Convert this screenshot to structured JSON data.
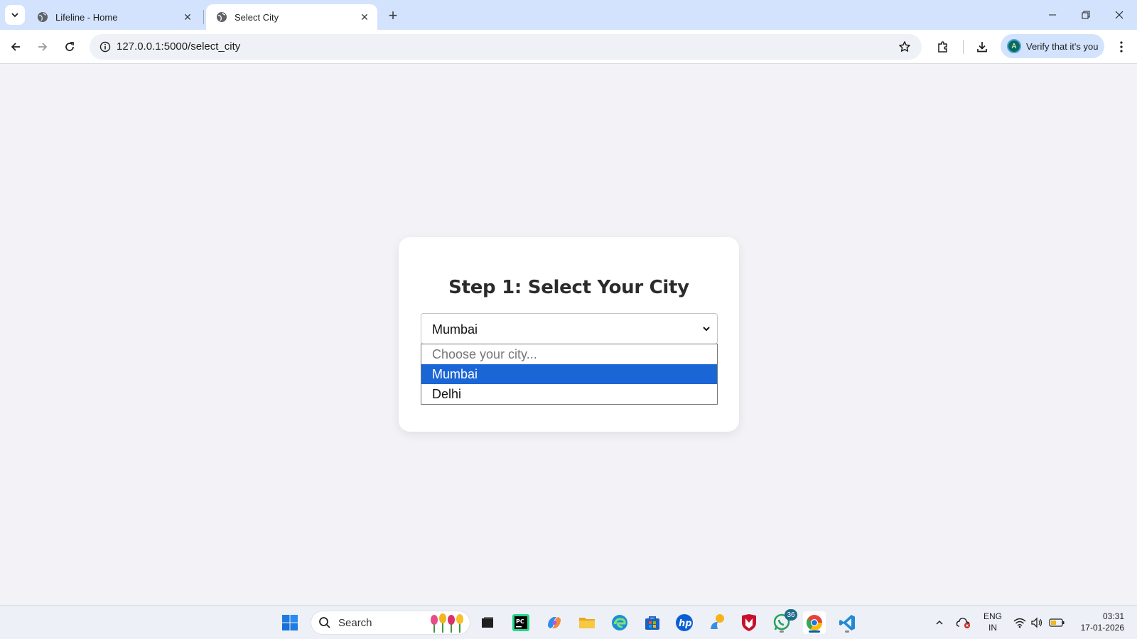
{
  "browser": {
    "tabs": [
      {
        "title": "Lifeline - Home",
        "active": false
      },
      {
        "title": "Select City",
        "active": true
      }
    ],
    "url": "127.0.0.1:5000/select_city",
    "profile": {
      "avatar_letter": "A",
      "label": "Verify that it's you"
    }
  },
  "page": {
    "heading": "Step 1: Select Your City",
    "city_select": {
      "value": "Mumbai",
      "options": [
        {
          "label": "Choose your city...",
          "placeholder": true
        },
        {
          "label": "Mumbai",
          "selected": true
        },
        {
          "label": "Delhi"
        }
      ]
    }
  },
  "taskbar": {
    "search_label": "Search",
    "whatsapp_badge": "36",
    "language": {
      "line1": "ENG",
      "line2": "IN"
    },
    "clock": {
      "time": "03:31",
      "date": "17-01-2026"
    }
  },
  "colors": {
    "accent": "#1b66d6",
    "tab_strip": "#d3e3fd",
    "page_background": "#f3f3f7"
  }
}
